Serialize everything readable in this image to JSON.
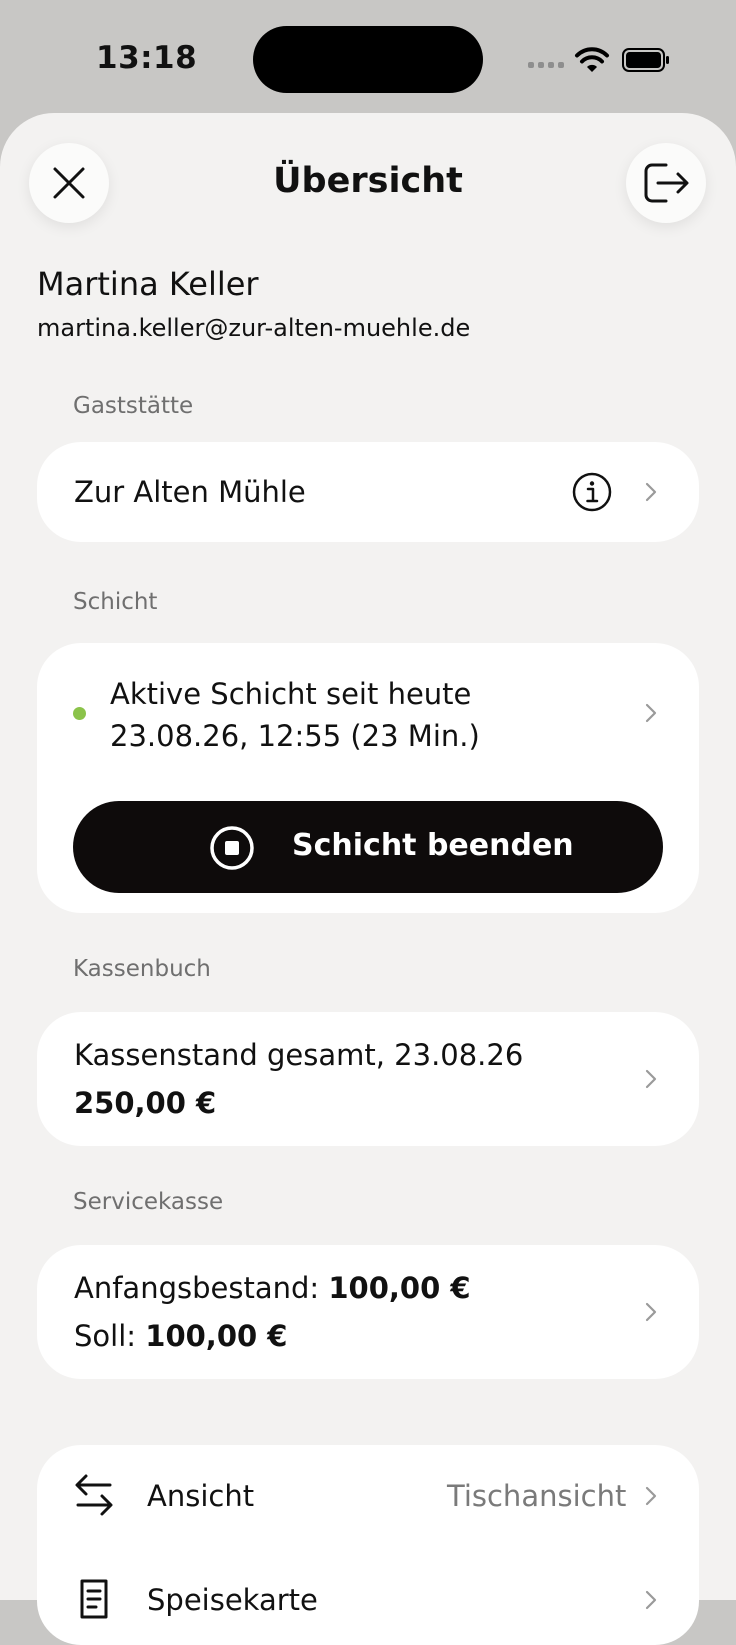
{
  "status_bar": {
    "time": "13:18"
  },
  "header": {
    "title": "Übersicht",
    "close_icon": "close-icon",
    "logout_icon": "logout-icon"
  },
  "user": {
    "name": "Martina Keller",
    "email": "martina.keller@zur-alten-muehle.de"
  },
  "gaststaette": {
    "label": "Gaststätte",
    "name": "Zur Alten Mühle",
    "info_icon": "info-icon"
  },
  "schicht": {
    "label": "Schicht",
    "status_line1": "Aktive Schicht seit heute",
    "status_line2": "23.08.26, 12:55 (23 Min.)",
    "status_color": "#8bc34a",
    "end_button": "Schicht beenden"
  },
  "kassenbuch": {
    "label": "Kassenbuch",
    "title": "Kassenstand gesamt, 23.08.26",
    "amount": "250,00 €"
  },
  "servicekasse": {
    "label": "Servicekasse",
    "anfang_label": "Anfangsbestand:",
    "anfang_value": "100,00 €",
    "soll_label": "Soll:",
    "soll_value": "100,00 €"
  },
  "settings": {
    "items": [
      {
        "label": "Ansicht",
        "value": "Tischansicht",
        "icon": "arrows-swap-icon"
      },
      {
        "label": "Speisekarte",
        "value": "",
        "icon": "menu-card-icon"
      }
    ]
  },
  "colors": {
    "accent": "#0e0b0b",
    "background": "#f3f2f1",
    "card": "#ffffff"
  }
}
